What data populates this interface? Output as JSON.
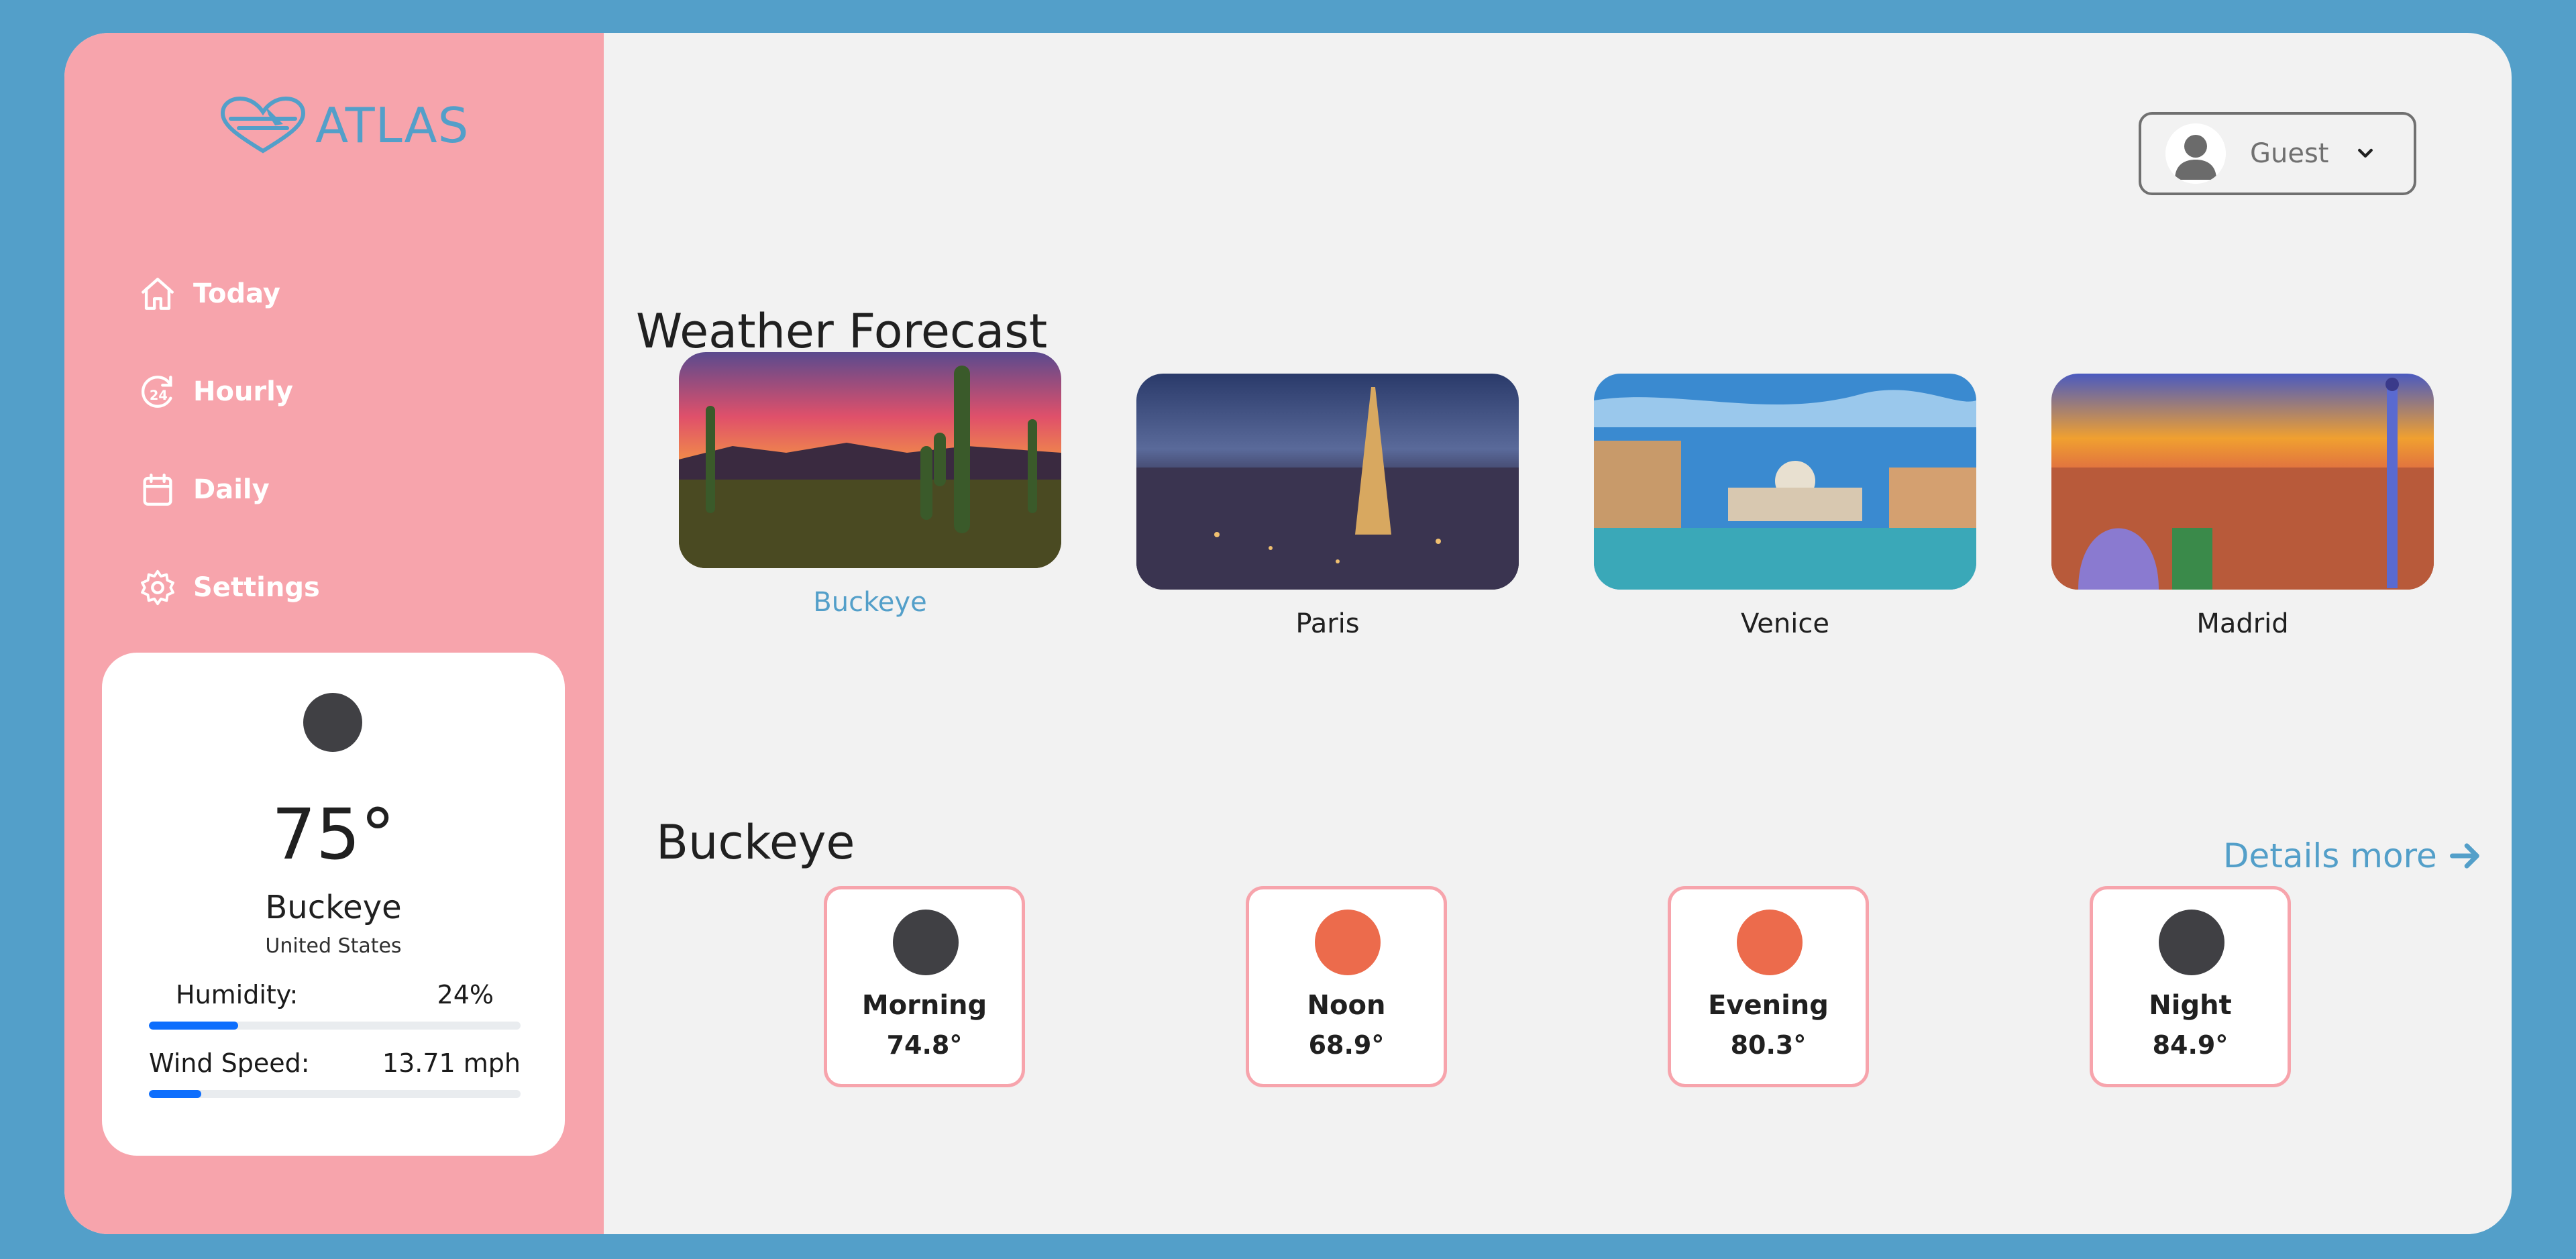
{
  "app": {
    "logo_text": "ATLAS"
  },
  "sidebar": {
    "items": [
      {
        "label": "Today",
        "icon": "home-icon"
      },
      {
        "label": "Hourly",
        "icon": "24-hour-icon"
      },
      {
        "label": "Daily",
        "icon": "calendar-icon"
      },
      {
        "label": "Settings",
        "icon": "gear-icon"
      }
    ]
  },
  "current": {
    "temperature": "75°",
    "city": "Buckeye",
    "country": "United States",
    "humidity_label": "Humidity:",
    "humidity_value": "24%",
    "humidity_fraction": 0.24,
    "wind_label": "Wind Speed:",
    "wind_value": "13.71 mph",
    "wind_fraction": 0.14,
    "icon_color": "#404044"
  },
  "user": {
    "name": "Guest"
  },
  "forecast": {
    "title": "Weather Forecast",
    "cities": [
      {
        "name": "Buckeye",
        "active": true
      },
      {
        "name": "Paris",
        "active": false
      },
      {
        "name": "Venice",
        "active": false
      },
      {
        "name": "Madrid",
        "active": false
      }
    ]
  },
  "selected": {
    "city": "Buckeye",
    "details_label": "Details more",
    "periods": [
      {
        "label": "Morning",
        "temp": "74.8°",
        "color": "#404044"
      },
      {
        "label": "Noon",
        "temp": "68.9°",
        "color": "#ec6b4c"
      },
      {
        "label": "Evening",
        "temp": "80.3°",
        "color": "#ec6b4c"
      },
      {
        "label": "Night",
        "temp": "84.9°",
        "color": "#404044"
      }
    ]
  },
  "colors": {
    "background": "#539fc9",
    "sidebar": "#f7a4ac",
    "accent": "#539fc9",
    "progress": "#0d6efd"
  }
}
